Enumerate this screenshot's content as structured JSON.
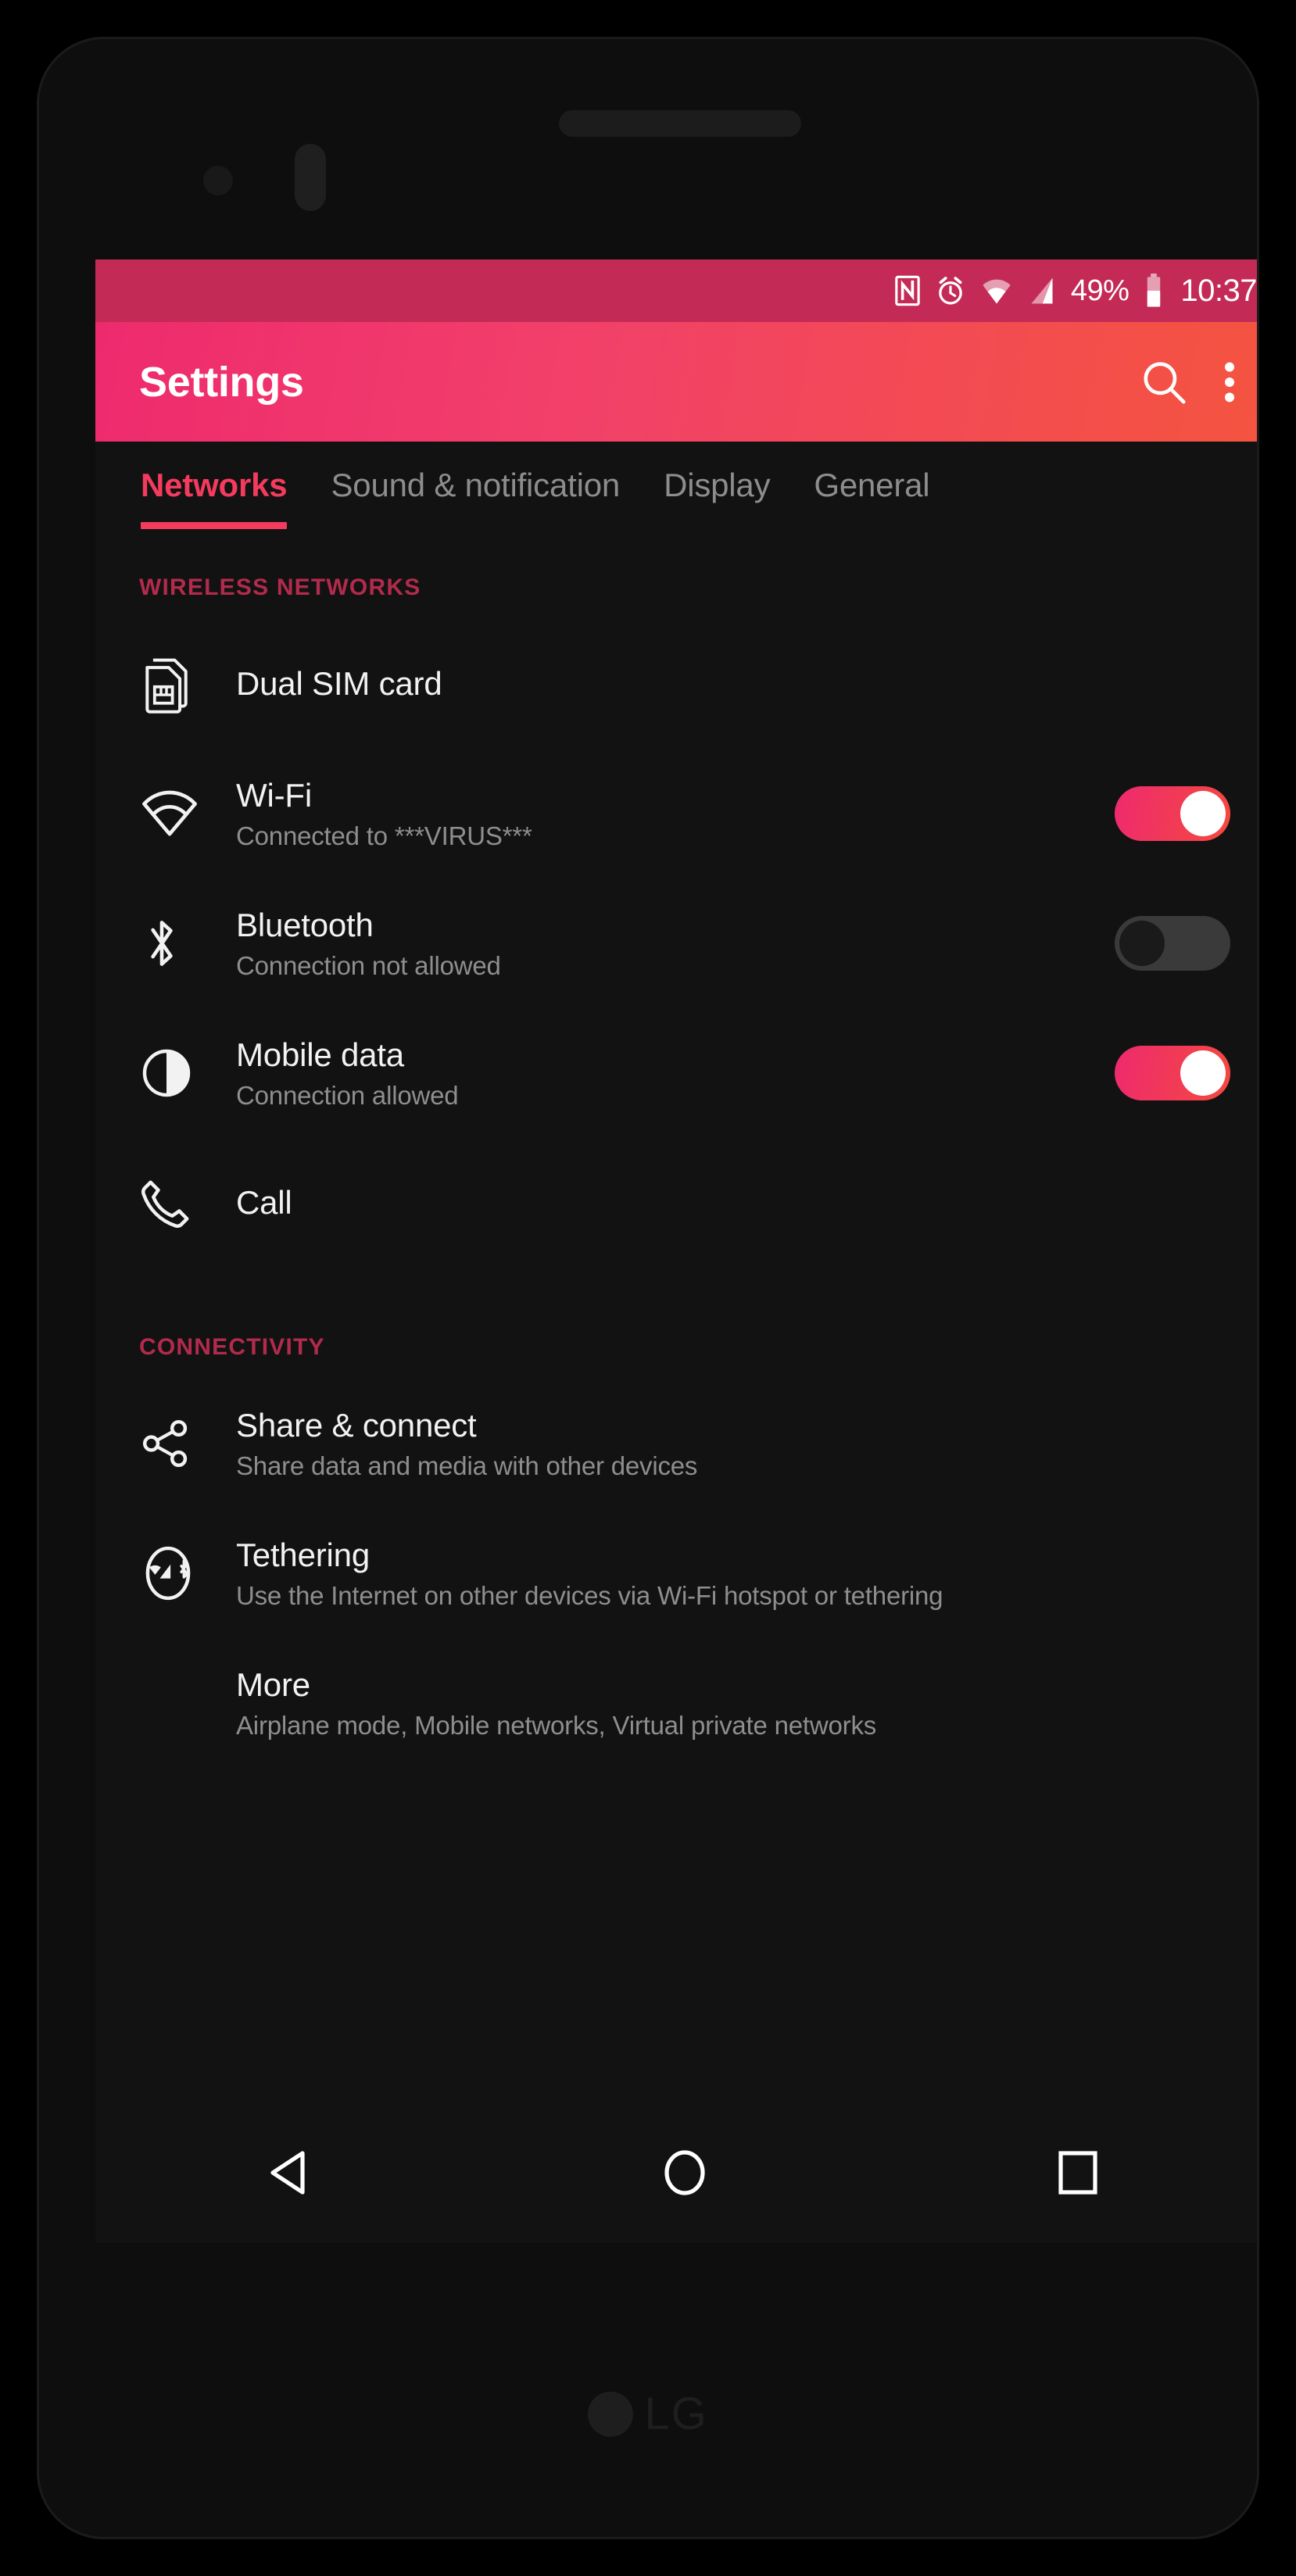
{
  "status_bar": {
    "icons": [
      "nfc-icon",
      "alarm-icon",
      "wifi-icon",
      "signal-icon"
    ],
    "battery_percent": "49%",
    "battery_icon": "battery-icon",
    "clock": "10:37",
    "background_color": "#c42a56"
  },
  "app_bar": {
    "title": "Settings",
    "search_icon": "search-icon",
    "overflow_icon": "more-vertical-icon",
    "gradient_start": "#ee2a6e",
    "gradient_end": "#f4543f"
  },
  "tabs": {
    "active_index": 0,
    "accent_color": "#f53b5d",
    "items": [
      {
        "label": "Networks"
      },
      {
        "label": "Sound & notification"
      },
      {
        "label": "Display"
      },
      {
        "label": "General"
      }
    ]
  },
  "sections": [
    {
      "header": "WIRELESS NETWORKS",
      "header_color": "#b22a4c",
      "rows": [
        {
          "icon": "dual-sim-card-icon",
          "title": "Dual SIM card",
          "subtitle": "",
          "toggle": null
        },
        {
          "icon": "wifi-icon",
          "title": "Wi-Fi",
          "subtitle": "Connected to ***VIRUS***",
          "toggle": "on"
        },
        {
          "icon": "bluetooth-icon",
          "title": "Bluetooth",
          "subtitle": "Connection not allowed",
          "toggle": "off"
        },
        {
          "icon": "mobile-data-icon",
          "title": "Mobile data",
          "subtitle": "Connection allowed",
          "toggle": "on"
        },
        {
          "icon": "phone-call-icon",
          "title": "Call",
          "subtitle": "",
          "toggle": null
        }
      ]
    },
    {
      "header": "CONNECTIVITY",
      "header_color": "#b22a4c",
      "rows": [
        {
          "icon": "share-nodes-icon",
          "title": "Share & connect",
          "subtitle": "Share data and media with other devices",
          "toggle": null
        },
        {
          "icon": "tethering-icon",
          "title": "Tethering",
          "subtitle": "Use the Internet on other devices via Wi-Fi hotspot or tethering",
          "toggle": null
        },
        {
          "icon": "",
          "title": "More",
          "subtitle": "Airplane mode, Mobile networks, Virtual private networks",
          "toggle": null
        }
      ]
    }
  ],
  "nav_bar": {
    "back": "back-triangle-icon",
    "home": "home-circle-icon",
    "recents": "recents-square-icon"
  },
  "branding": {
    "logo_text": "LG"
  }
}
